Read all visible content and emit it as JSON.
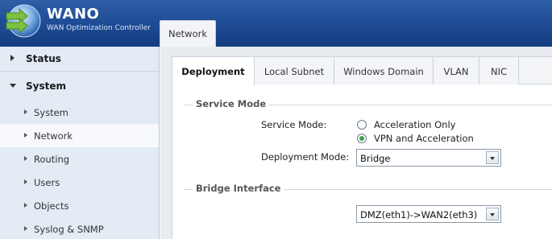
{
  "header": {
    "brand": "WANO",
    "tagline": "WAN Optimization Controller",
    "top_tab": "Network"
  },
  "sidebar": {
    "sections": [
      {
        "label": "Status",
        "expanded": false
      },
      {
        "label": "System",
        "expanded": true
      }
    ],
    "items": [
      {
        "label": "System"
      },
      {
        "label": "Network",
        "active": true
      },
      {
        "label": "Routing"
      },
      {
        "label": "Users"
      },
      {
        "label": "Objects"
      },
      {
        "label": "Syslog & SNMP"
      }
    ]
  },
  "tabs": [
    "Deployment",
    "Local Subnet",
    "Windows Domain",
    "VLAN",
    "NIC"
  ],
  "active_tab": "Deployment",
  "service_mode": {
    "title": "Service Mode",
    "service_mode_label": "Service Mode:",
    "options": [
      "Acceleration Only",
      "VPN and Acceleration"
    ],
    "selected": "VPN and Acceleration",
    "deployment_mode_label": "Deployment Mode:",
    "deployment_mode_value": "Bridge"
  },
  "bridge_interface": {
    "title": "Bridge Interface",
    "value": "DMZ(eth1)->WAN2(eth3)"
  },
  "colors": {
    "header_bg": "#1d4a93",
    "sidebar_bg": "#e3ebf5",
    "radio_checked": "#3aa14a"
  }
}
